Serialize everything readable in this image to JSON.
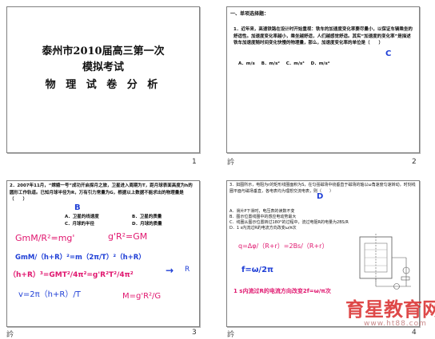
{
  "slides": [
    {
      "number": "1",
      "title_line1": "泰州市2010届高三第一次",
      "title_line2": "模拟考试",
      "title_line3": "物 理 试 卷 分 析"
    },
    {
      "number": "2",
      "note_icon": "訡",
      "heading": "一、单项选择题：",
      "question": "1．近年来，高速铁路在设计时开始重视：铁车的加速度变化率要尽量小，以保证车辆乘坐的舒适性。加速度变化率越小，乘坐越舒适，人们越感觉舒适。其实“加速度的变化率”是描述铁车加速度随时间变化快慢的物理量，那么，加速度变化率的单位是（　　）",
      "answer": "C",
      "options": [
        "A．m/s",
        "B．m/s²",
        "C．m/s³",
        "D．m/s⁴"
      ]
    },
    {
      "number": "3",
      "note_icon": "訡",
      "question": "2．2007年11月，“嫦娥一号”成功开启探月之旅，卫星进入周期为T，距月球表面高度为h的圆形工作轨道。已知月球半径为R，万有引力常量为G，根据以上数据不能求出的物理量是（　　）",
      "answer": "B",
      "options": [
        "A．卫星的线速度",
        "B．卫星的质量",
        "C．月球的半径",
        "D．月球的质量"
      ],
      "formulas": {
        "f1": "GmM/R²=mg'",
        "f2": "g'R²=GM",
        "f3": "GmM/（h+R）²=m（2π/T）²（h+R）",
        "f4": "（h+R）³=GMT²/4π²=g'R²T²/4π²",
        "arrow": "→",
        "r": "R",
        "f5": "v=2π（h+R）/T",
        "f6": "M=g'R²/G"
      }
    },
    {
      "number": "4",
      "note_icon": "訡",
      "question": "3．如图所示，电阻为r的矩形线圈面积为S，在匀强磁场中绕垂直于磁场的轴以ω角速度匀速转动，时刻线圈平面与磁场垂直，各电表均为理想交流电表，则（　　）",
      "answer": "D",
      "options": [
        "A．滑片P下滑时，电压表的读数不变",
        "B．图示位置线圈中的感应电动势最大",
        "C．线圈从图示位置转过180°的过程中，流过电阻R的电量为2BS/R",
        "D．1 s内流过R的电流方向改变ω/π次"
      ],
      "formulas": {
        "f1": "q=Δφ/（R+r）=2Bs/（R+r）",
        "f2": "f=ω/2π",
        "f3": "1 s内流过R的电流方向改变2f=ω/π次"
      }
    }
  ],
  "watermark": {
    "text": "育星教育网",
    "url": "www.ht88.com"
  }
}
